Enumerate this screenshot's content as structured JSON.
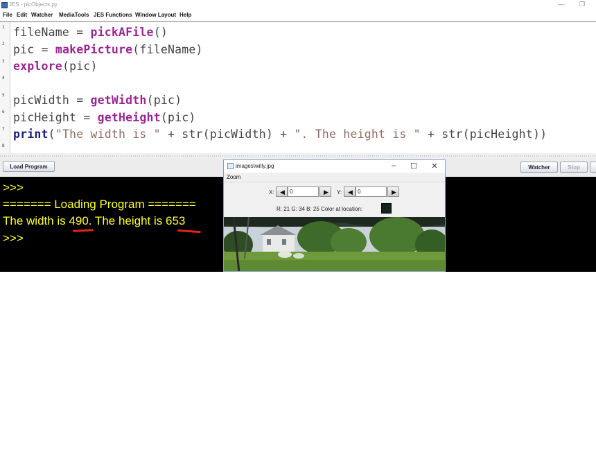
{
  "window": {
    "title": "JES - picObjects.py"
  },
  "menu": [
    "File",
    "Edit",
    "Watcher",
    "MediaTools",
    "JES Functions",
    "Window Layout",
    "Help"
  ],
  "editor": {
    "line_numbers": [
      "1",
      "2",
      "3",
      "4",
      "5",
      "6",
      "7",
      "8"
    ]
  },
  "controls": {
    "load_label": "Load Program",
    "watcher_label": "Watcher",
    "stop_label": "Stop"
  },
  "console": {
    "lines": [
      ">>>",
      "======= Loading Program =======",
      "The width is 490. The height is 653",
      ">>>"
    ]
  },
  "explorer": {
    "title": "images\\willy.jpg",
    "menu_zoom": "Zoom",
    "x_label": "X:",
    "x_value": "0",
    "y_label": "Y:",
    "y_value": "0",
    "pixel_info": "R: 21 G: 34 B: 25 Color at location:",
    "swatch_color": "#152219"
  },
  "colors": {
    "keyword": "#9a2592",
    "print_keyword": "#1c1e80",
    "string": "#8d6a61",
    "console_text": "#ffff2a",
    "underline": "#e0241e"
  }
}
